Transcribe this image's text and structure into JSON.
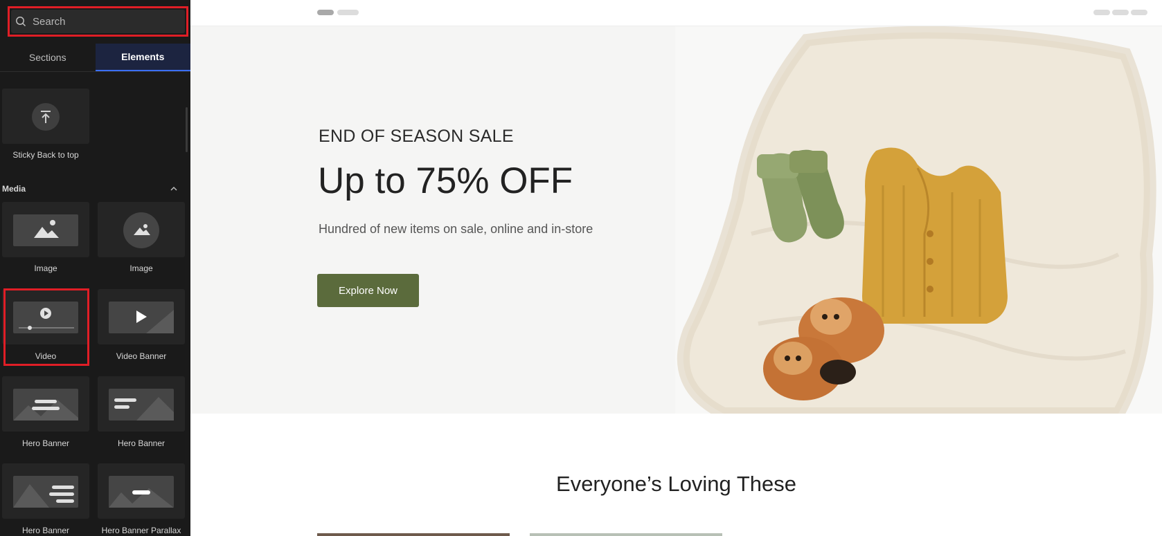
{
  "sidebar": {
    "search": {
      "placeholder": "Search"
    },
    "tabs": [
      {
        "label": "Sections"
      },
      {
        "label": "Elements"
      }
    ],
    "elements": [
      {
        "label": "Sticky Back to top",
        "icon": "arrow-up-to-top-icon"
      },
      {
        "label": "Image",
        "icon": "image-icon"
      },
      {
        "label": "Image",
        "icon": "image-circle-icon"
      },
      {
        "label": "Video",
        "icon": "video-player-icon"
      },
      {
        "label": "Video Banner",
        "icon": "video-banner-icon"
      },
      {
        "label": "Hero Banner",
        "icon": "hero-banner-icon"
      },
      {
        "label": "Hero Banner",
        "icon": "hero-banner-left-icon"
      },
      {
        "label": "Hero Banner",
        "icon": "hero-banner-right-icon"
      },
      {
        "label": "Hero Banner Parallax",
        "icon": "hero-banner-parallax-icon"
      }
    ],
    "media_section": {
      "title": "Media"
    }
  },
  "hero": {
    "eyebrow": "END OF SEASON SALE",
    "title": "Up to 75% OFF",
    "subtitle": "Hundred of new items on sale, online and in-store",
    "cta": "Explore Now"
  },
  "products_section": {
    "title": "Everyone’s Loving These"
  },
  "colors": {
    "accent": "#5b6b3c",
    "highlight": "#e01e26",
    "tab_active_underline": "#3b6ff5",
    "sidebar_bg": "#1a1a1a"
  }
}
